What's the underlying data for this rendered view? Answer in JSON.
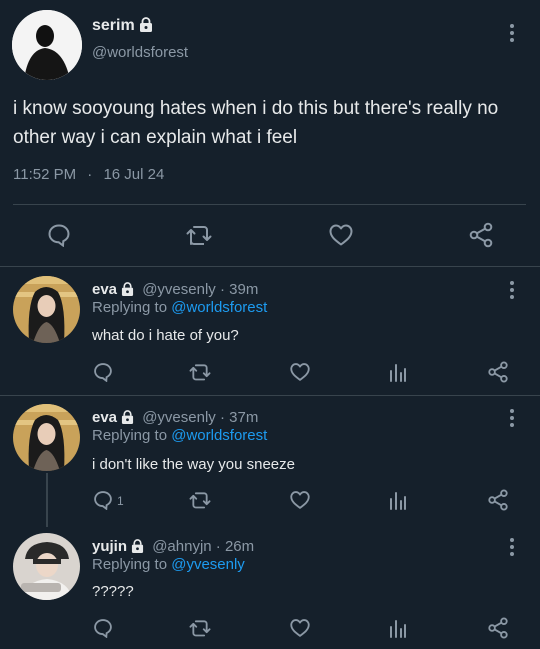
{
  "main_tweet": {
    "display_name": "serim",
    "handle": "@worldsforest",
    "text_line1": "i know sooyoung hates when i do this but there's really no",
    "text_line2": "other way i can explain what i feel",
    "time": "11:52 PM",
    "date": "16 Jul 24",
    "separator": "·"
  },
  "replies": [
    {
      "display_name": "eva",
      "handle": "@yvesenly",
      "age": "39m",
      "replying_label": "Replying to ",
      "replying_to": "@worldsforest",
      "text": "what do i hate of you?",
      "reply_count": ""
    },
    {
      "display_name": "eva",
      "handle": "@yvesenly",
      "age": "37m",
      "replying_label": "Replying to ",
      "replying_to": "@worldsforest",
      "text": "i don't like the way you sneeze",
      "reply_count": "1"
    },
    {
      "display_name": "yujin",
      "handle": "@ahnyjn",
      "age": "26m",
      "replying_label": "Replying to ",
      "replying_to": "@yvesenly",
      "text": "?????",
      "reply_count": ""
    }
  ],
  "colors": {
    "background": "#15202b",
    "text": "#e7e9ea",
    "muted": "#8b98a5",
    "link": "#1d9bf0",
    "divider": "#38444d"
  },
  "icons": [
    "lock-icon",
    "more-icon",
    "reply-icon",
    "retweet-icon",
    "like-icon",
    "share-icon",
    "analytics-icon"
  ]
}
